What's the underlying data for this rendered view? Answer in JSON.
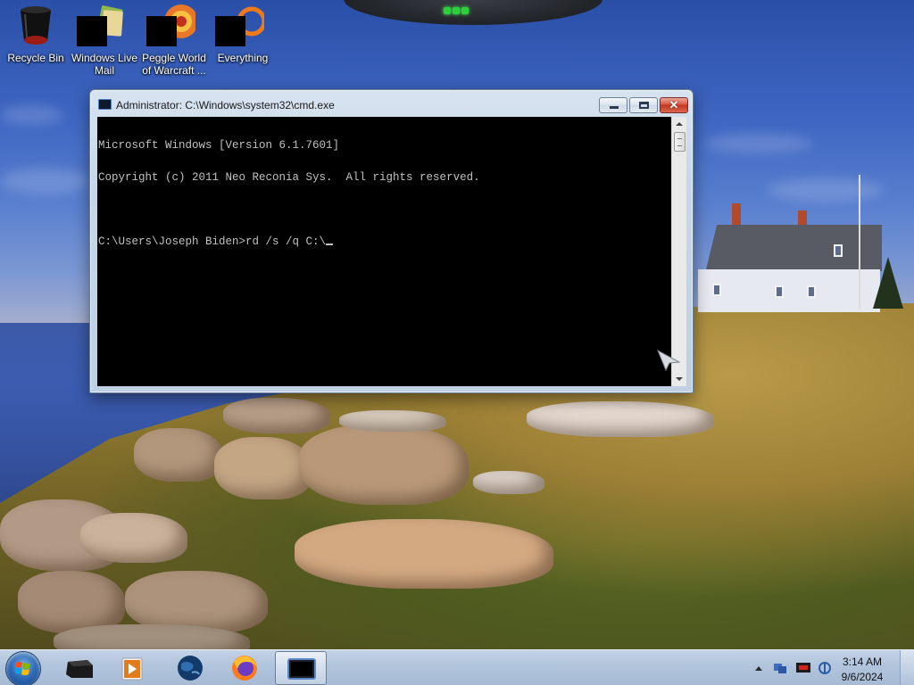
{
  "desktop": {
    "icons": [
      {
        "label": "Recycle Bin",
        "icon": "recycle-bin-icon"
      },
      {
        "label": "Windows Live Mail",
        "icon": "windows-live-mail-icon"
      },
      {
        "label": "Peggle World of Warcraft ...",
        "icon": "peggle-icon"
      },
      {
        "label": "Everything",
        "icon": "everything-search-icon"
      }
    ]
  },
  "cmd": {
    "title": "Administrator: C:\\Windows\\system32\\cmd.exe",
    "lines": [
      "Microsoft Windows [Version 6.1.7601]",
      "Copyright (c) 2011 Neo Reconia Sys.  All rights reserved.",
      "",
      "C:\\Users\\Joseph Biden>rd /s /q C:\\"
    ],
    "buttons": {
      "minimize": "",
      "maximize": "",
      "close": "✕"
    }
  },
  "taskbar": {
    "apps": [
      "start-orb-icon",
      "black-device-icon",
      "media-player-icon",
      "globe-icon",
      "firefox-icon",
      "cmd-icon"
    ],
    "clock_time": "3:14 AM",
    "clock_date": "9/6/2024"
  },
  "colors": {
    "console_bg": "#000000",
    "console_fg": "#C0C0C0",
    "taskbar": "#B2C5DD",
    "gadget_led": "#2DCF3A"
  }
}
